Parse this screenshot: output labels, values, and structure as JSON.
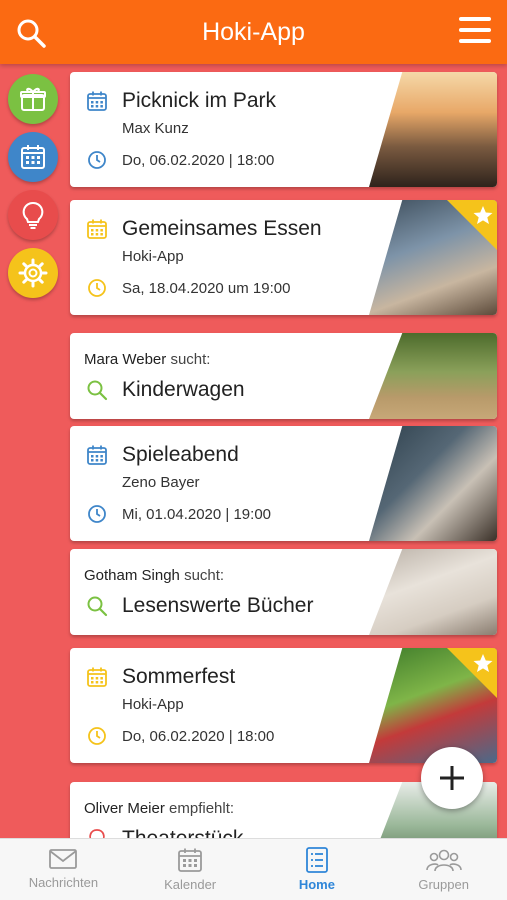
{
  "header": {
    "title": "Hoki-App",
    "search_icon": "search-icon",
    "menu_icon": "hamburger-menu-icon"
  },
  "side_buttons": [
    {
      "icon": "gift-icon",
      "color": "#7bc142"
    },
    {
      "icon": "calendar-icon",
      "color": "#3f86c9"
    },
    {
      "icon": "lightbulb-icon",
      "color": "#e84c4c"
    },
    {
      "icon": "gear-icon",
      "color": "#f5c31b"
    }
  ],
  "cards": [
    {
      "kind": "event",
      "title": "Picknick im Park",
      "author": "Max Kunz",
      "date": "Do, 06.02.2020 | 18:00",
      "accent": "#3f86c9",
      "starred": false
    },
    {
      "kind": "event",
      "title": "Gemeinsames Essen",
      "author": "Hoki-App",
      "date": "Sa, 18.04.2020 um 19:00",
      "accent": "#f5c31b",
      "starred": true
    },
    {
      "kind": "search",
      "person": "Mara Weber",
      "verb": "sucht:",
      "title": "Kinderwagen",
      "accent": "#7bc142"
    },
    {
      "kind": "event",
      "title": "Spieleabend",
      "author": "Zeno Bayer",
      "date": "Mi, 01.04.2020 | 19:00",
      "accent": "#3f86c9",
      "starred": false
    },
    {
      "kind": "search",
      "person": "Gotham Singh",
      "verb": "sucht:",
      "title": "Lesenswerte Bücher",
      "accent": "#7bc142"
    },
    {
      "kind": "event",
      "title": "Sommerfest",
      "author": "Hoki-App",
      "date": "Do, 06.02.2020 | 18:00",
      "accent": "#f5c31b",
      "starred": true
    },
    {
      "kind": "recommend",
      "person": "Oliver Meier",
      "verb": "empfiehlt:",
      "title": "Theaterstück",
      "accent": "#e84c4c"
    }
  ],
  "tabs": [
    {
      "label": "Nachrichten",
      "icon": "envelope-icon",
      "active": false
    },
    {
      "label": "Kalender",
      "icon": "calendar-icon",
      "active": false
    },
    {
      "label": "Home",
      "icon": "list-icon",
      "active": true
    },
    {
      "label": "Gruppen",
      "icon": "group-icon",
      "active": false
    }
  ],
  "colors": {
    "header": "#fb6a12",
    "background": "#ef5b5b",
    "active_tab": "#2f86d8",
    "star": "#f5c31b"
  }
}
